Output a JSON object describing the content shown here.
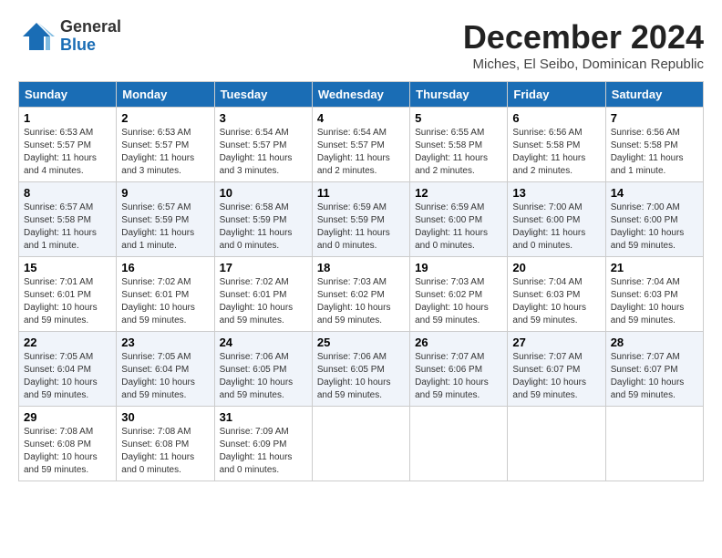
{
  "header": {
    "logo_general": "General",
    "logo_blue": "Blue",
    "month_title": "December 2024",
    "subtitle": "Miches, El Seibo, Dominican Republic"
  },
  "weekdays": [
    "Sunday",
    "Monday",
    "Tuesday",
    "Wednesday",
    "Thursday",
    "Friday",
    "Saturday"
  ],
  "weeks": [
    [
      {
        "day": "1",
        "info": "Sunrise: 6:53 AM\nSunset: 5:57 PM\nDaylight: 11 hours\nand 4 minutes."
      },
      {
        "day": "2",
        "info": "Sunrise: 6:53 AM\nSunset: 5:57 PM\nDaylight: 11 hours\nand 3 minutes."
      },
      {
        "day": "3",
        "info": "Sunrise: 6:54 AM\nSunset: 5:57 PM\nDaylight: 11 hours\nand 3 minutes."
      },
      {
        "day": "4",
        "info": "Sunrise: 6:54 AM\nSunset: 5:57 PM\nDaylight: 11 hours\nand 2 minutes."
      },
      {
        "day": "5",
        "info": "Sunrise: 6:55 AM\nSunset: 5:58 PM\nDaylight: 11 hours\nand 2 minutes."
      },
      {
        "day": "6",
        "info": "Sunrise: 6:56 AM\nSunset: 5:58 PM\nDaylight: 11 hours\nand 2 minutes."
      },
      {
        "day": "7",
        "info": "Sunrise: 6:56 AM\nSunset: 5:58 PM\nDaylight: 11 hours\nand 1 minute."
      }
    ],
    [
      {
        "day": "8",
        "info": "Sunrise: 6:57 AM\nSunset: 5:58 PM\nDaylight: 11 hours\nand 1 minute."
      },
      {
        "day": "9",
        "info": "Sunrise: 6:57 AM\nSunset: 5:59 PM\nDaylight: 11 hours\nand 1 minute."
      },
      {
        "day": "10",
        "info": "Sunrise: 6:58 AM\nSunset: 5:59 PM\nDaylight: 11 hours\nand 0 minutes."
      },
      {
        "day": "11",
        "info": "Sunrise: 6:59 AM\nSunset: 5:59 PM\nDaylight: 11 hours\nand 0 minutes."
      },
      {
        "day": "12",
        "info": "Sunrise: 6:59 AM\nSunset: 6:00 PM\nDaylight: 11 hours\nand 0 minutes."
      },
      {
        "day": "13",
        "info": "Sunrise: 7:00 AM\nSunset: 6:00 PM\nDaylight: 11 hours\nand 0 minutes."
      },
      {
        "day": "14",
        "info": "Sunrise: 7:00 AM\nSunset: 6:00 PM\nDaylight: 10 hours\nand 59 minutes."
      }
    ],
    [
      {
        "day": "15",
        "info": "Sunrise: 7:01 AM\nSunset: 6:01 PM\nDaylight: 10 hours\nand 59 minutes."
      },
      {
        "day": "16",
        "info": "Sunrise: 7:02 AM\nSunset: 6:01 PM\nDaylight: 10 hours\nand 59 minutes."
      },
      {
        "day": "17",
        "info": "Sunrise: 7:02 AM\nSunset: 6:01 PM\nDaylight: 10 hours\nand 59 minutes."
      },
      {
        "day": "18",
        "info": "Sunrise: 7:03 AM\nSunset: 6:02 PM\nDaylight: 10 hours\nand 59 minutes."
      },
      {
        "day": "19",
        "info": "Sunrise: 7:03 AM\nSunset: 6:02 PM\nDaylight: 10 hours\nand 59 minutes."
      },
      {
        "day": "20",
        "info": "Sunrise: 7:04 AM\nSunset: 6:03 PM\nDaylight: 10 hours\nand 59 minutes."
      },
      {
        "day": "21",
        "info": "Sunrise: 7:04 AM\nSunset: 6:03 PM\nDaylight: 10 hours\nand 59 minutes."
      }
    ],
    [
      {
        "day": "22",
        "info": "Sunrise: 7:05 AM\nSunset: 6:04 PM\nDaylight: 10 hours\nand 59 minutes."
      },
      {
        "day": "23",
        "info": "Sunrise: 7:05 AM\nSunset: 6:04 PM\nDaylight: 10 hours\nand 59 minutes."
      },
      {
        "day": "24",
        "info": "Sunrise: 7:06 AM\nSunset: 6:05 PM\nDaylight: 10 hours\nand 59 minutes."
      },
      {
        "day": "25",
        "info": "Sunrise: 7:06 AM\nSunset: 6:05 PM\nDaylight: 10 hours\nand 59 minutes."
      },
      {
        "day": "26",
        "info": "Sunrise: 7:07 AM\nSunset: 6:06 PM\nDaylight: 10 hours\nand 59 minutes."
      },
      {
        "day": "27",
        "info": "Sunrise: 7:07 AM\nSunset: 6:07 PM\nDaylight: 10 hours\nand 59 minutes."
      },
      {
        "day": "28",
        "info": "Sunrise: 7:07 AM\nSunset: 6:07 PM\nDaylight: 10 hours\nand 59 minutes."
      }
    ],
    [
      {
        "day": "29",
        "info": "Sunrise: 7:08 AM\nSunset: 6:08 PM\nDaylight: 10 hours\nand 59 minutes."
      },
      {
        "day": "30",
        "info": "Sunrise: 7:08 AM\nSunset: 6:08 PM\nDaylight: 11 hours\nand 0 minutes."
      },
      {
        "day": "31",
        "info": "Sunrise: 7:09 AM\nSunset: 6:09 PM\nDaylight: 11 hours\nand 0 minutes."
      },
      {
        "day": "",
        "info": ""
      },
      {
        "day": "",
        "info": ""
      },
      {
        "day": "",
        "info": ""
      },
      {
        "day": "",
        "info": ""
      }
    ]
  ]
}
